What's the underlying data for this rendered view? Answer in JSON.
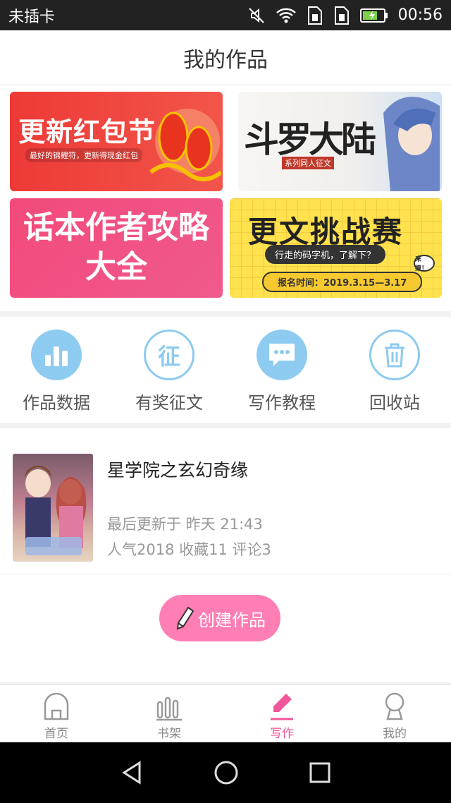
{
  "status_bar": {
    "carrier": "未插卡",
    "time": "00:56"
  },
  "header": {
    "title": "我的作品"
  },
  "banners": {
    "red_packet": {
      "title": "更新红包节",
      "subtitle": "最好的锦鲤符，更新得现金红包"
    },
    "douluo": {
      "title": "斗罗大陆",
      "subtitle": "系列同人征文"
    },
    "guide": {
      "title": "话本作者攻略大全"
    },
    "challenge": {
      "title": "更文挑战赛",
      "subtitle": "行走的码字机，了解下？",
      "date": "报名时间：2019.3.15—3.17",
      "badge": "来撩！"
    }
  },
  "quick_actions": [
    {
      "label": "作品数据",
      "icon": "bar-chart-icon"
    },
    {
      "label": "有奖征文",
      "icon": "zheng-icon",
      "glyph": "征"
    },
    {
      "label": "写作教程",
      "icon": "chat-bubble-icon"
    },
    {
      "label": "回收站",
      "icon": "trash-icon"
    }
  ],
  "work": {
    "title": "星学院之玄幻奇缘",
    "updated": "最后更新于 昨天 21:43",
    "stats": "人气2018 收藏11 评论3"
  },
  "create_button": {
    "label": "创建作品"
  },
  "tabs": [
    {
      "label": "首页",
      "icon": "home-icon"
    },
    {
      "label": "书架",
      "icon": "bookshelf-icon"
    },
    {
      "label": "写作",
      "icon": "pen-icon",
      "active": true
    },
    {
      "label": "我的",
      "icon": "profile-icon"
    }
  ],
  "colors": {
    "accent": "#f0569a",
    "icon_blue": "#8ecbf0",
    "create_button": "#ff7eb3"
  }
}
